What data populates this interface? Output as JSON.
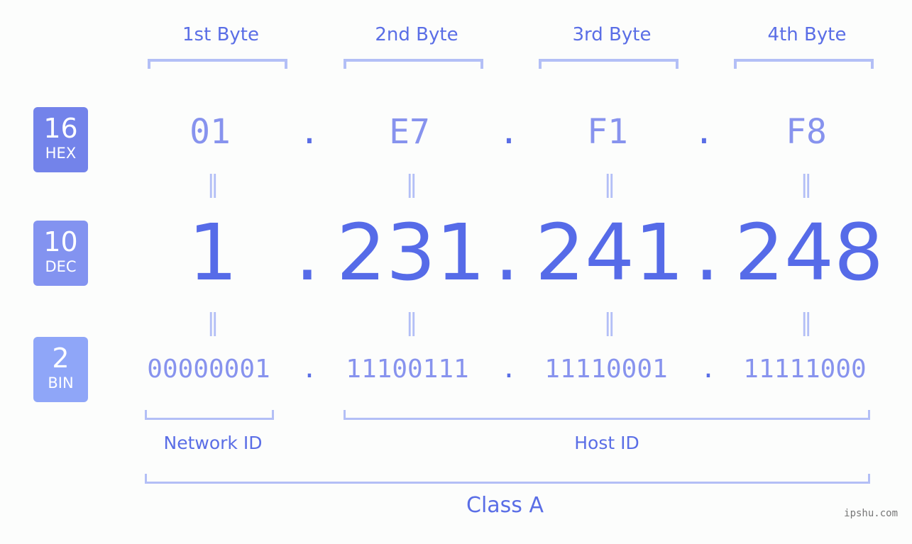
{
  "badges": [
    {
      "num": "16",
      "label": "HEX",
      "color": "#7383ea"
    },
    {
      "num": "10",
      "label": "DEC",
      "color": "#8393f0"
    },
    {
      "num": "2",
      "label": "BIN",
      "color": "#8fa6f8"
    }
  ],
  "bytes": [
    {
      "label": "1st Byte",
      "hex": "01",
      "dec": "1",
      "bin": "00000001"
    },
    {
      "label": "2nd Byte",
      "hex": "E7",
      "dec": "231",
      "bin": "11100111"
    },
    {
      "label": "3rd Byte",
      "hex": "F1",
      "dec": "241",
      "bin": "11110001"
    },
    {
      "label": "4th Byte",
      "hex": "F8",
      "dec": "248",
      "bin": "11111000"
    }
  ],
  "separator": ".",
  "equals": "=",
  "network_id_label": "Network ID",
  "host_id_label": "Host ID",
  "class_label": "Class A",
  "watermark": "ipshu.com",
  "colors": {
    "accent": "#566be8",
    "light": "#8793ee",
    "bracket": "#b3bff6"
  }
}
